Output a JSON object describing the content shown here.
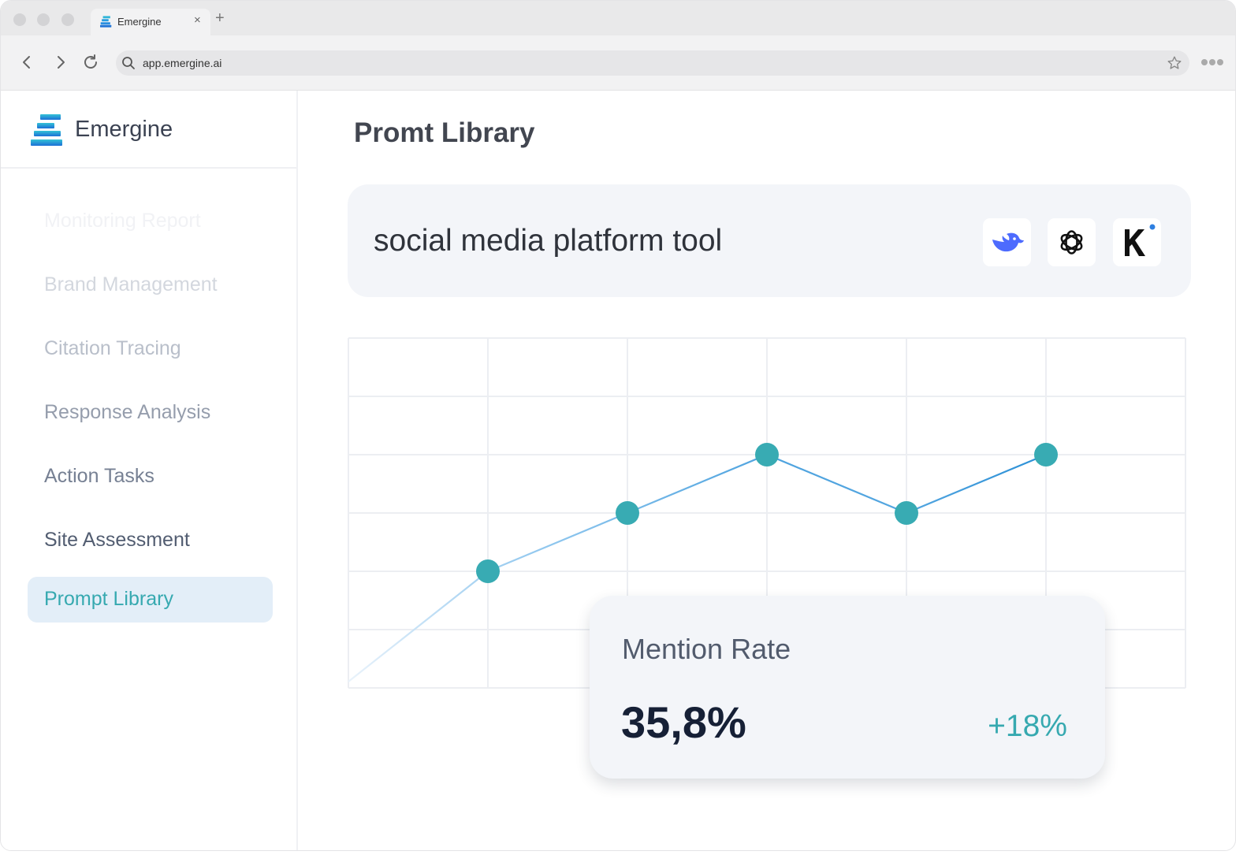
{
  "browser": {
    "tab_title": "Emergine",
    "tab_close": "×",
    "new_tab": "+",
    "url": "app.emergine.ai"
  },
  "sidebar": {
    "brand_name": "Emergine",
    "items": [
      {
        "label": "Monitoring Report",
        "color": "#f1f2f5"
      },
      {
        "label": "Brand Management",
        "color": "#d3d7de"
      },
      {
        "label": "Citation Tracing",
        "color": "#b9bfca"
      },
      {
        "label": "Response Analysis",
        "color": "#959dac"
      },
      {
        "label": "Action Tasks",
        "color": "#768093"
      },
      {
        "label": "Site Assessment",
        "color": "#525d71"
      },
      {
        "label": "Prompt Library",
        "color": "#36a9b0",
        "active": true
      }
    ]
  },
  "main": {
    "title": "Promt Library",
    "prompt": {
      "text": "social media platform tool",
      "models": [
        "deepseek-icon",
        "openai-icon",
        "kimi-icon"
      ]
    },
    "stat": {
      "label": "Mention Rate",
      "value": "35,8%",
      "change": "+18%"
    }
  },
  "chart_data": {
    "type": "line",
    "grid": true,
    "points": [
      {
        "col": 0,
        "row": 6
      },
      {
        "col": 1,
        "row": 4
      },
      {
        "col": 2,
        "row": 3
      },
      {
        "col": 3,
        "row": 2
      },
      {
        "col": 4,
        "row": 3
      },
      {
        "col": 5,
        "row": 2
      }
    ],
    "columns": 6,
    "rows": 6,
    "marker_color": "#38abb3",
    "line_color": "#2a8fd6"
  }
}
